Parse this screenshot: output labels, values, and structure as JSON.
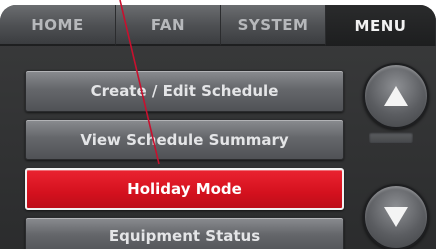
{
  "tabs": {
    "home": "HOME",
    "fan": "FAN",
    "system": "SYSTEM",
    "menu": "MENU",
    "active": "menu"
  },
  "menu": {
    "items": [
      {
        "label": "Create / Edit Schedule",
        "selected": false
      },
      {
        "label": "View Schedule Summary",
        "selected": false
      },
      {
        "label": "Holiday Mode",
        "selected": true
      },
      {
        "label": "Equipment Status",
        "selected": false
      }
    ]
  },
  "scroll": {
    "up_icon": "arrow-up-icon",
    "down_icon": "arrow-down-icon"
  },
  "colors": {
    "selected": "#e01a26",
    "screen_bg": "#2f3031",
    "pointer": "#c8102e"
  }
}
